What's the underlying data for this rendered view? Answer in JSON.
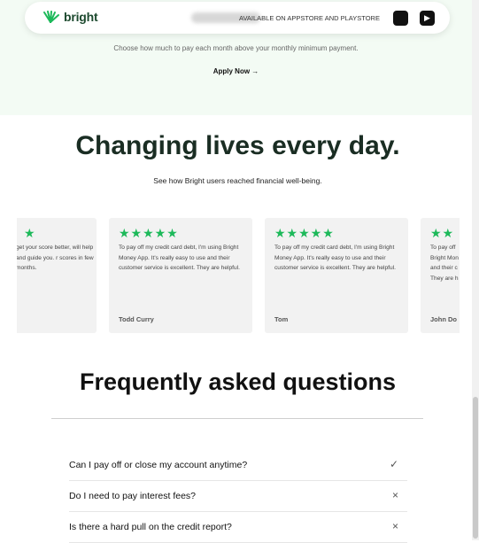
{
  "header": {
    "brand": "bright",
    "store_text": "AVAILABLE ON APPSTORE AND PLAYSTORE",
    "apple_icon": "apple-icon",
    "play_icon": "play-store-icon"
  },
  "hero": {
    "subtitle": "Choose how much to pay each month above your monthly minimum payment.",
    "apply_label": "Apply Now →"
  },
  "reviews_section": {
    "title": "Changing lives every day.",
    "subtitle": "See how Bright users reached financial well-being.",
    "reviews": [
      {
        "stars": "★",
        "text": "get your score better, will help and guide you. r scores in few months.",
        "name": ""
      },
      {
        "stars": "★★★★★",
        "text": "To pay off my credit card debt, I'm using Bright Money App. It's really easy to use and their customer service is excellent. They are helpful.",
        "name": "Todd Curry"
      },
      {
        "stars": "★★★★★",
        "text": "To pay off my credit card debt, I'm using Bright Money App. It's really easy to use and their customer service is excellent. They are helpful.",
        "name": "Tom"
      },
      {
        "stars": "★★",
        "text": "To pay off Bright Mon and their c They are h",
        "name": "John Do"
      }
    ]
  },
  "faq": {
    "title": "Frequently asked questions",
    "items": [
      {
        "question": "Can I pay off or close my account anytime?",
        "icon": "✓"
      },
      {
        "question": "Do I need to pay interest fees?",
        "icon": "×"
      },
      {
        "question": "Is there a hard pull on the credit report?",
        "icon": "×"
      }
    ]
  },
  "colors": {
    "hero_bg": "#f3fbf4",
    "brand_green": "#1db95a",
    "title_dark": "#1a2d23"
  }
}
